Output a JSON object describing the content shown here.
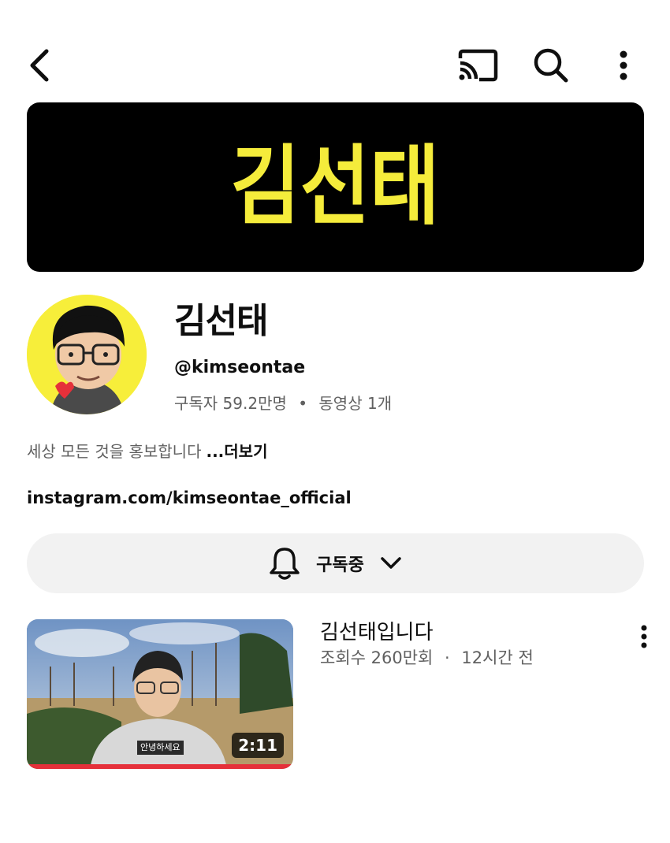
{
  "header": {
    "back_icon": "back-arrow-icon",
    "cast_icon": "cast-icon",
    "search_icon": "search-icon",
    "more_icon": "more-vertical-icon"
  },
  "banner": {
    "text": "김선태",
    "background": "#000000",
    "text_color": "#f5ec3b"
  },
  "channel": {
    "name": "김선태",
    "handle": "@kimseontae",
    "subscribers": "구독자 59.2만명",
    "stat_separator": "•",
    "videos": "동영상 1개",
    "description": "세상 모든 것을 홍보합니다",
    "more_label": "...더보기",
    "link": "instagram.com/kimseontae_official"
  },
  "subscribe": {
    "label": "구독중",
    "bell_icon": "bell-icon",
    "chevron_icon": "chevron-down-icon"
  },
  "videos": [
    {
      "title": "김선태입니다",
      "views": "조회수 260만회",
      "separator": "·",
      "age": "12시간 전",
      "duration": "2:11",
      "caption": "안녕하세요",
      "watched_progress": 1.0,
      "progress_color": "#e5303a"
    }
  ]
}
